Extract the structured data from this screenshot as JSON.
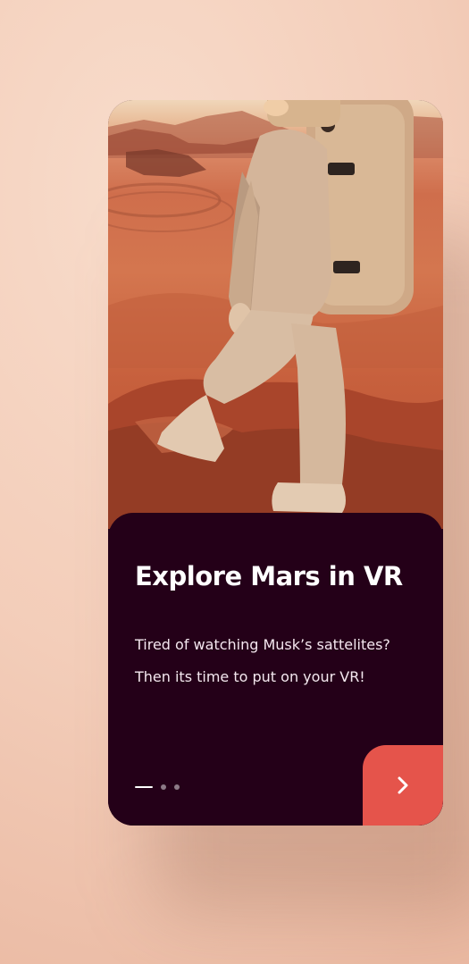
{
  "onboarding": {
    "title": "Explore Mars in VR",
    "description_line1": "Tired of watching Musk’s sattelites?",
    "description_line2": "Then its time to put on your VR!",
    "total_steps": 3,
    "current_step": 1
  },
  "colors": {
    "panel_background": "#240018",
    "accent": "#e5544b",
    "background": "#f3cdb9"
  },
  "icons": {
    "next": "chevron-right-icon"
  }
}
